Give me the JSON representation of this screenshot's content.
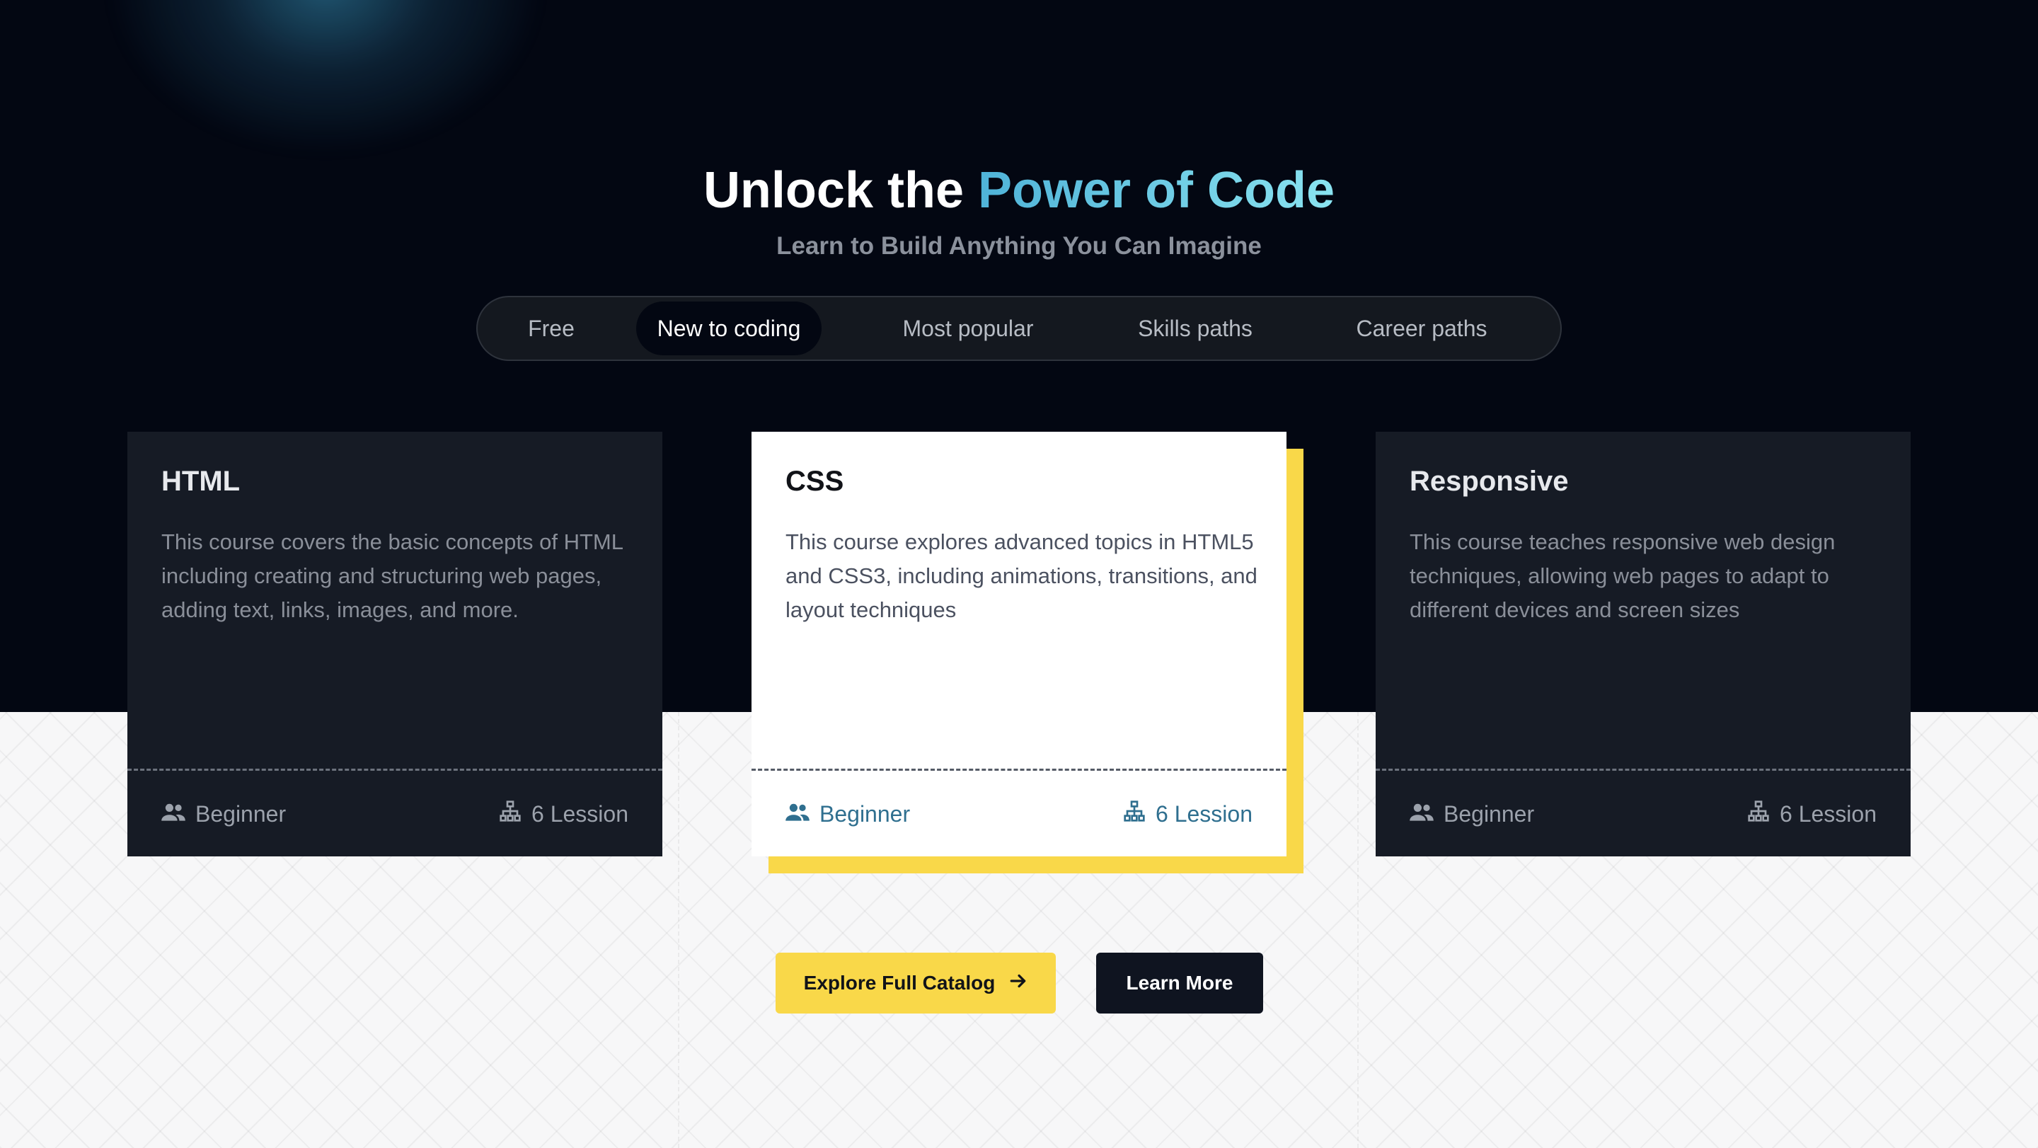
{
  "hero": {
    "title_plain": "Unlock the ",
    "title_accent": "Power of Code",
    "subtitle": "Learn to Build Anything You Can Imagine"
  },
  "tabs": [
    {
      "label": "Free",
      "active": false
    },
    {
      "label": "New to coding",
      "active": true
    },
    {
      "label": "Most popular",
      "active": false
    },
    {
      "label": "Skills paths",
      "active": false
    },
    {
      "label": "Career paths",
      "active": false
    }
  ],
  "courses": [
    {
      "title": "HTML",
      "description": "This course covers the basic concepts of HTML including creating and structuring web pages, adding text, links, images, and more.",
      "level": "Beginner",
      "lessons": "6 Lession",
      "highlighted": false
    },
    {
      "title": "CSS",
      "description": "This course explores advanced topics in HTML5 and CSS3, including animations, transitions, and layout techniques",
      "level": "Beginner",
      "lessons": "6 Lession",
      "highlighted": true
    },
    {
      "title": "Responsive",
      "description": "This course teaches responsive web design techniques, allowing web pages to adapt to different devices and screen sizes",
      "level": "Beginner",
      "lessons": "6 Lession",
      "highlighted": false
    }
  ],
  "buttons": {
    "explore_label": "Explore Full Catalog",
    "learn_more_label": "Learn More"
  },
  "icons": {
    "level": "users-icon",
    "lessons": "sitemap-icon",
    "explore": "arrow-right-icon"
  },
  "colors": {
    "dark_bg": "#030712",
    "card_dark": "#161b25",
    "accent_yellow": "#f9d849",
    "accent_cyan": "#5cc3e0",
    "link_blue": "#2f6f8f"
  }
}
